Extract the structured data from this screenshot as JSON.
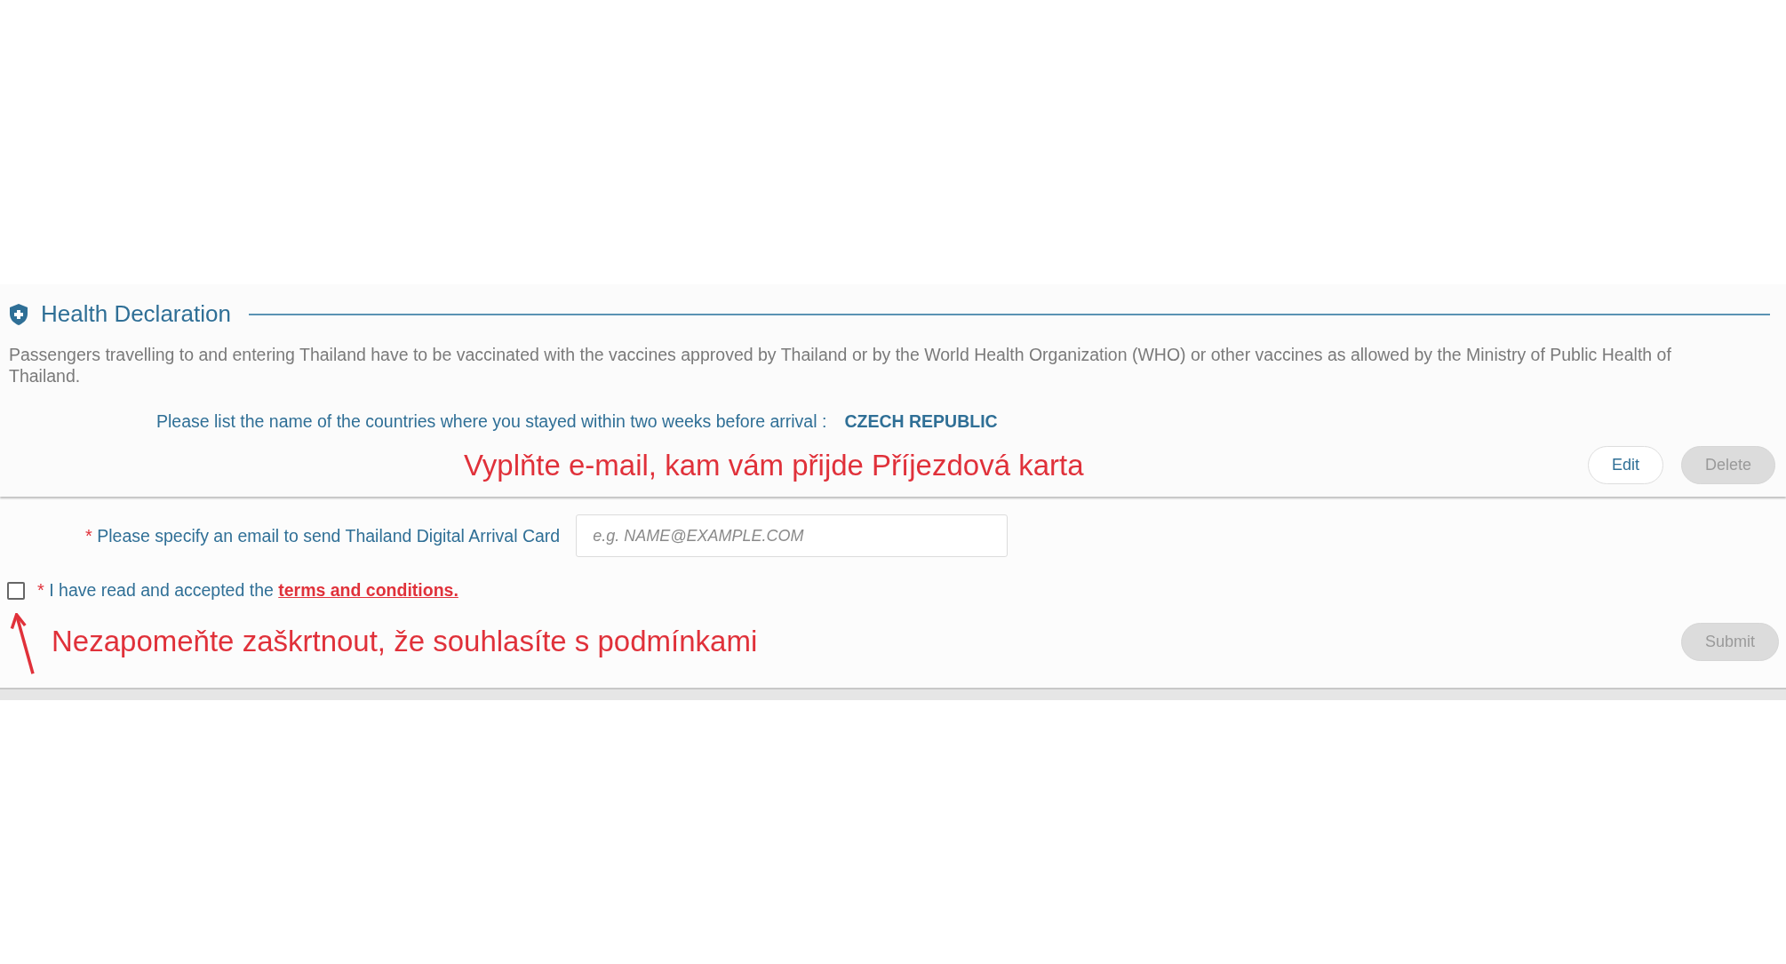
{
  "section": {
    "title": "Health Declaration"
  },
  "notice": "Passengers travelling to and entering Thailand have to be vaccinated with the vaccines approved by Thailand or by the World Health Organization (WHO) or other vaccines as allowed by the Ministry of Public Health of Thailand.",
  "countries": {
    "label": "Please list the name of the countries where you stayed within two weeks before arrival :",
    "value": "CZECH REPUBLIC"
  },
  "annotation_email": "Vyplňte e-mail, kam vám přijde Příjezdová karta",
  "card_buttons": [
    {
      "label": "Edit",
      "disabled": false
    },
    {
      "label": "Delete",
      "disabled": true
    }
  ],
  "email": {
    "required_mark": "*",
    "label": "Please specify an email to send Thailand Digital Arrival Card",
    "placeholder": "e.g. NAME@EXAMPLE.COM"
  },
  "terms": {
    "checked": false,
    "required_mark": "*",
    "text": "I have read and accepted the",
    "link": "terms and conditions."
  },
  "annotation_terms": "Nezapomeňte zaškrtnout, že souhlasíte s podmínkami",
  "submit": {
    "label": "Submit",
    "disabled": true
  }
}
